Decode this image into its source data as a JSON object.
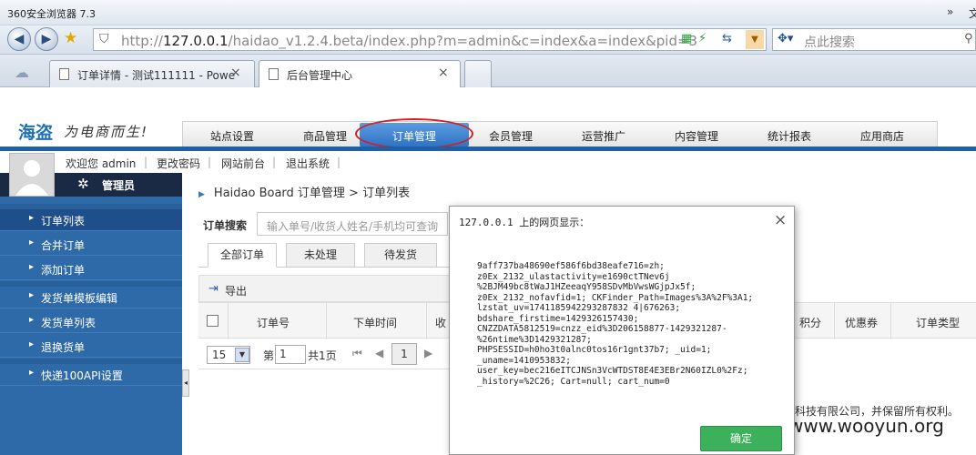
{
  "browser": {
    "title": "360安全浏览器 7.3",
    "title_right": "»",
    "title_right2": "文",
    "url_gray1": "http://",
    "url_host": "127.0.0.1",
    "url_path": "/haidao_v1.2.4.beta/index.php?m=admin&c=index&a=index&pid=3",
    "search_placeholder": "点此搜索",
    "tabs": [
      {
        "label": "订单详情 - 测试111111 - Powe",
        "close": "×"
      },
      {
        "label": "后台管理中心",
        "close": "×"
      }
    ]
  },
  "header": {
    "logo": "海盗",
    "slogan": "为电商而生!",
    "nav": [
      "站点设置",
      "商品管理",
      "订单管理",
      "会员管理",
      "运营推广",
      "内容管理",
      "统计报表",
      "应用商店"
    ],
    "active_nav": "订单管理"
  },
  "user": {
    "welcome": "欢迎您 admin",
    "links": [
      "更改密码",
      "网站前台",
      "退出系统"
    ],
    "sep": "|",
    "role": "管理员"
  },
  "sidebar": {
    "groups": [
      [
        "订单列表",
        "合并订单",
        "添加订单"
      ],
      [
        "发货单模板编辑",
        "发货单列表",
        "退换货单"
      ],
      [
        "快递100API设置"
      ]
    ],
    "active": "订单列表",
    "arrow": "▸"
  },
  "content": {
    "breadcrumb": "Haidao Board 订单管理 > 订单列表",
    "search_label": "订单搜索",
    "search_placeholder": "输入单号/收货人姓名/手机均可查询",
    "tabs": [
      "全部订单",
      "未处理",
      "待发货"
    ],
    "export_label": "导出",
    "columns": [
      "订单号",
      "下单时间",
      "收",
      "积分",
      "优惠券",
      "订单类型"
    ],
    "pager": {
      "page_size": "15",
      "page_prefix": "第",
      "page_value": "1",
      "total": "共1页",
      "current": "1"
    },
    "footer": "科技有限公司，并保留所有权利。",
    "watermark": "www.wooyun.org"
  },
  "dialog": {
    "title": "127.0.0.1 上的网页显示：",
    "close": "×",
    "lines": [
      "9aff737ba48690ef586f6bd38eafe716=zh;",
      "z0Ex_2132_ulastactivity=e1690ctTNev6j",
      "%2BJM49bc8tWaJ1HZeeaqY958SDvMbVwsWGjpJx5f;",
      "z0Ex_2132_nofavfid=1; CKFinder_Path=Images%3A%2F%3A1;",
      "lzstat_uv=1741185942293287832 4|676263;",
      "bdshare_firstime=1429326157430;",
      "CNZZDATA5812519=cnzz_eid%3D206158877-1429321287-",
      "%26ntime%3D1429321287;",
      "PHPSESSID=h0ho3t0alnc0tos16r1gnt37b7; _uid=1;",
      "_uname=1410953832;",
      "user_key=bec216eITCJNSn3VcWTDST8E4E3EBr2N60IZL0%2Fz;",
      "_history=%2C26; Cart=null; cart_num=0"
    ],
    "ok_label": "确定"
  }
}
